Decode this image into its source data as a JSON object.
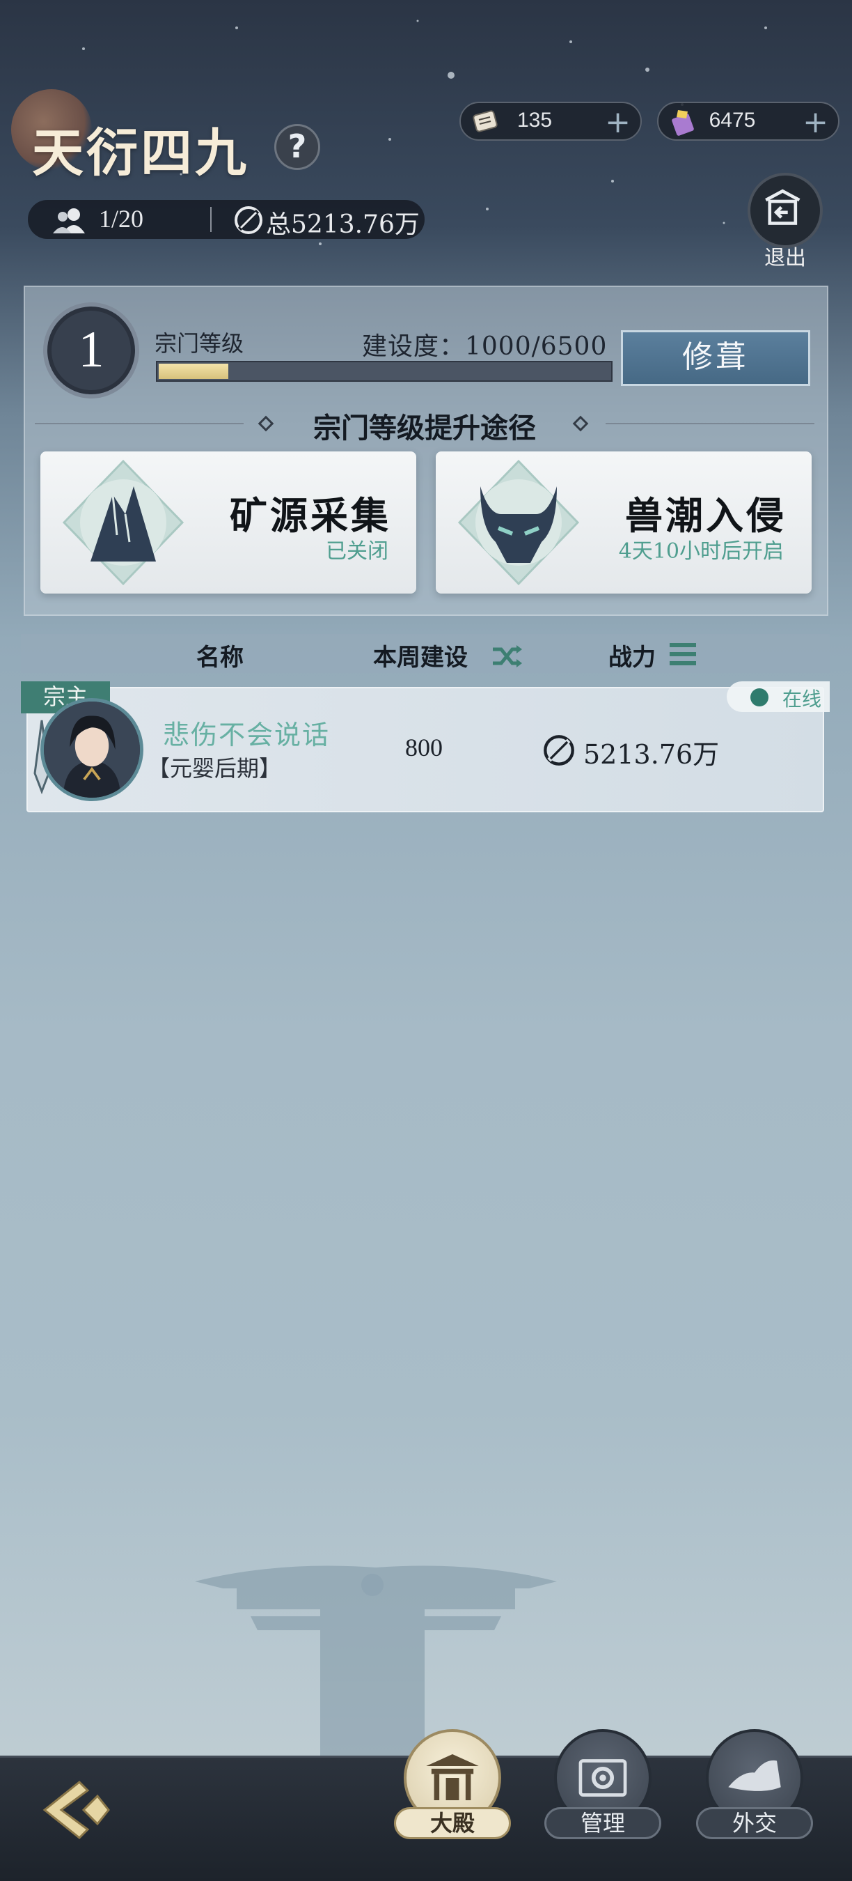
{
  "header": {
    "sect_name": "天衍四九",
    "help_symbol": "?",
    "members": "1/20",
    "total_power": "总5213.76万",
    "resources": [
      {
        "icon": "scroll-token-icon",
        "value": "135",
        "plus": "+"
      },
      {
        "icon": "purple-talisman-icon",
        "value": "6475",
        "plus": "+"
      }
    ],
    "exit_label": "退出"
  },
  "level_panel": {
    "level": "1",
    "level_label": "宗门等级",
    "construction_text": "建设度：1000/6500",
    "construction_progress": 0.1538,
    "repair_label": "修葺",
    "routes_title": "宗门等级提升途径",
    "features": [
      {
        "name": "矿源采集",
        "status": "已关闭",
        "icon": "mountain-icon"
      },
      {
        "name": "兽潮入侵",
        "status": "4天10小时后开启",
        "icon": "demon-mask-icon"
      }
    ]
  },
  "table": {
    "headers": {
      "name": "名称",
      "weekly_build": "本周建设",
      "power": "战力"
    },
    "rows": [
      {
        "role_tag": "宗主",
        "online_text": "在线",
        "name": "悲伤不会说话",
        "rank": "【元婴后期】",
        "weekly_build": "800",
        "power": "5213.76万"
      }
    ]
  },
  "bottom_nav": {
    "items": [
      {
        "label": "大殿",
        "icon": "hall-icon",
        "active": true
      },
      {
        "label": "管理",
        "icon": "gear-scroll-icon",
        "active": false
      },
      {
        "label": "外交",
        "icon": "handshake-icon",
        "active": false
      }
    ]
  },
  "colors": {
    "accent_teal": "#4f9e8f",
    "button_blue": "#4f7391",
    "progress_gold": "#e6d28f"
  }
}
